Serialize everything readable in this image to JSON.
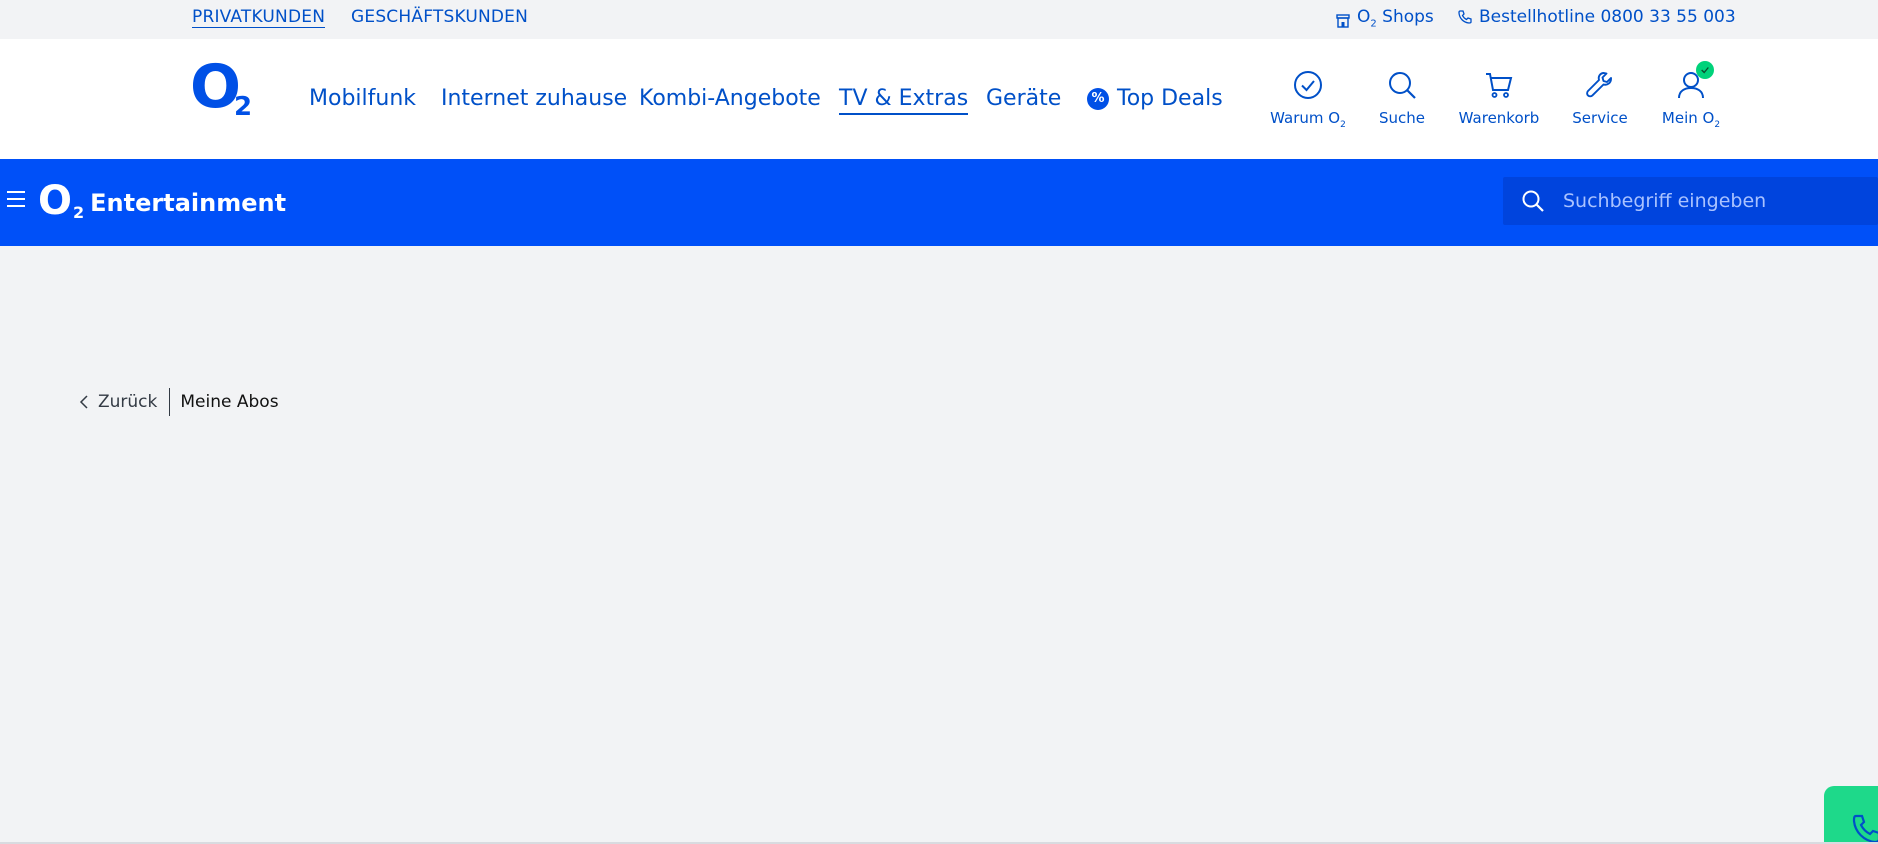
{
  "topbar": {
    "segments": [
      "PRIVATKUNDEN",
      "GESCHÄFTSKUNDEN"
    ],
    "shops_label_prefix": "O",
    "shops_label_sub": "2",
    "shops_label_suffix": " Shops",
    "hotline_label": "Bestellhotline 0800 33 55 003",
    "icons": {
      "shops": "shop-icon",
      "hotline": "phone-icon"
    }
  },
  "header": {
    "logo": {
      "letter": "O",
      "sub": "2"
    },
    "nav": [
      "Mobilfunk",
      "Internet zuhause",
      "Kombi-Angebote",
      "TV & Extras",
      "Geräte",
      "Top Deals"
    ],
    "active_nav": "TV & Extras",
    "deal_badge": "%",
    "actions": {
      "warum": {
        "label": "Warum O",
        "sub": "2",
        "icon": "check-circle-icon"
      },
      "suche": {
        "label": "Suche",
        "icon": "search-icon"
      },
      "warenkorb": {
        "label": "Warenkorb",
        "icon": "cart-icon"
      },
      "service": {
        "label": "Service",
        "icon": "wrench-icon"
      },
      "mein": {
        "label": "Mein O",
        "sub": "2",
        "icon": "user-icon"
      }
    }
  },
  "entertainment": {
    "logo_letter": "O",
    "logo_sub": "2",
    "title": "Entertainment",
    "search_placeholder": "Suchbegriff eingeben"
  },
  "breadcrumb": {
    "back_label": "Zurück",
    "current": "Meine Abos"
  },
  "colors": {
    "brand_blue": "#0050f8",
    "link_blue": "#0050c8",
    "online_green": "#00d27a",
    "chat_green": "#1ed98a",
    "page_bg": "#f2f3f5"
  }
}
